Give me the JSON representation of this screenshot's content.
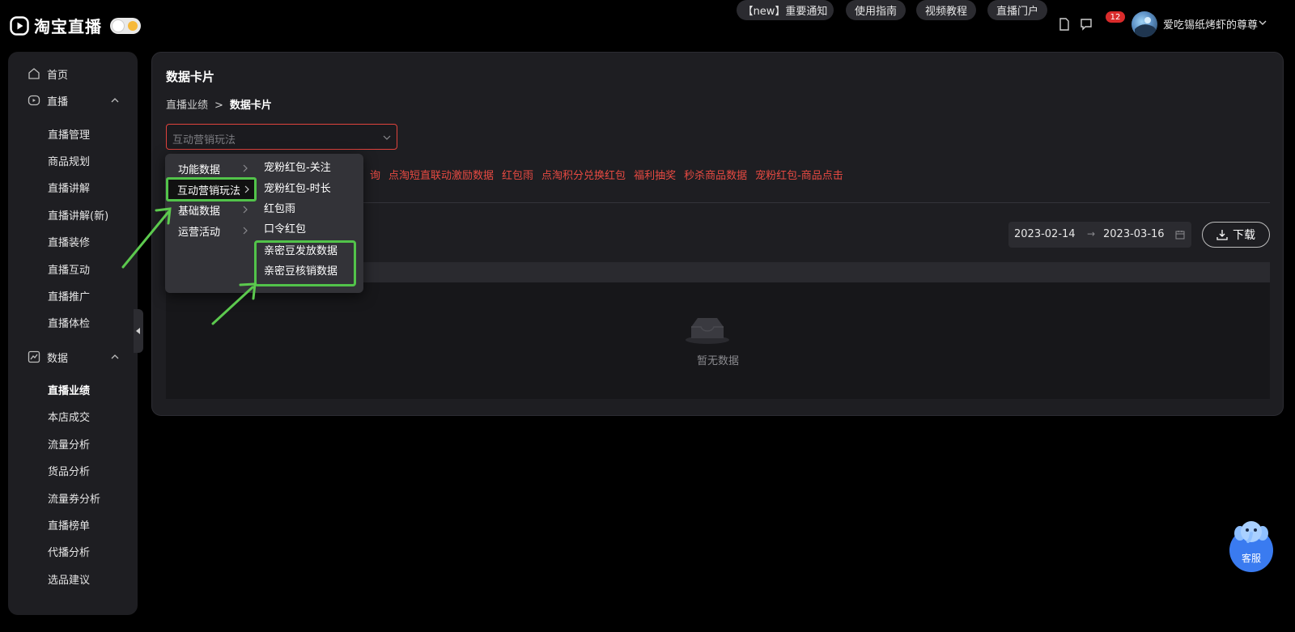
{
  "header": {
    "logo_text": "淘宝直播",
    "links": [
      "【new】重要通知",
      "使用指南",
      "视频教程",
      "直播门户"
    ],
    "notification_count": "12",
    "username": "爱吃锡纸烤虾的尊尊"
  },
  "sidebar": {
    "home": "首页",
    "live_group": {
      "label": "直播",
      "items": [
        "直播管理",
        "商品规划",
        "直播讲解",
        "直播讲解(新)",
        "直播装修",
        "直播互动",
        "直播推广",
        "直播体检"
      ]
    },
    "data_group": {
      "label": "数据",
      "items": [
        "直播业绩",
        "本店成交",
        "流量分析",
        "货品分析",
        "流量券分析",
        "直播榜单",
        "代播分析",
        "选品建议"
      ],
      "active": "直播业绩"
    }
  },
  "main": {
    "title": "数据卡片",
    "breadcrumb": {
      "parent": "直播业绩",
      "sep": ">",
      "current": "数据卡片"
    },
    "select_placeholder": "互动营销玩法",
    "tags": [
      "询",
      "点淘短直联动激励数据",
      "红包雨",
      "点淘积分兑换红包",
      "福利抽奖",
      "秒杀商品数据",
      "宠粉红包-商品点击"
    ],
    "date_start": "2023-02-14",
    "date_sep": "→",
    "date_end": "2023-03-16",
    "download_label": "下载",
    "empty_text": "暂无数据"
  },
  "cascader": {
    "level1": [
      "功能数据",
      "互动营销玩法",
      "基础数据",
      "运营活动"
    ],
    "level1_active": "互动营销玩法",
    "level2": [
      "宠粉红包-关注",
      "宠粉红包-时长",
      "红包雨",
      "口令红包",
      "亲密豆发放数据",
      "亲密豆核销数据"
    ]
  },
  "customer_service": {
    "label": "客服"
  },
  "colors": {
    "accent_red": "#e84a42",
    "highlight_green": "#52c34a",
    "panel": "#1e1e22"
  }
}
